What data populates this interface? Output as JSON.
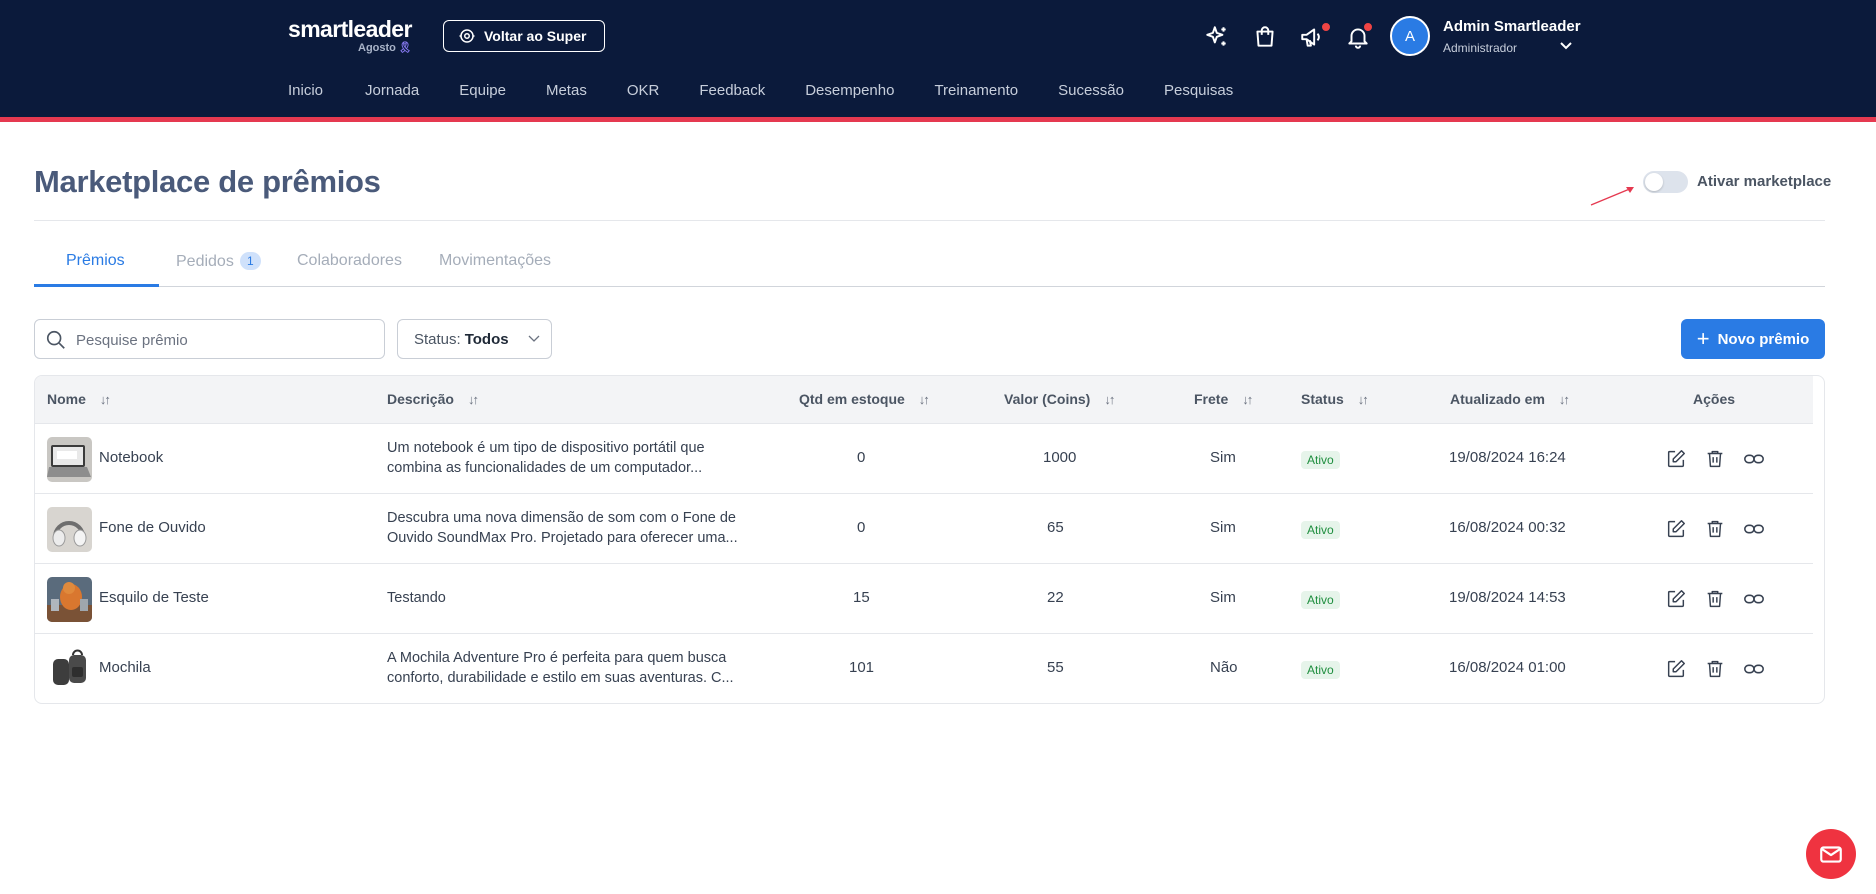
{
  "header": {
    "logo": "smartleader",
    "logo_sub": "Agosto",
    "logo_ribbon": "🎗",
    "back_button": "Voltar ao Super",
    "nav": [
      "Inicio",
      "Jornada",
      "Equipe",
      "Metas",
      "OKR",
      "Feedback",
      "Desempenho",
      "Treinamento",
      "Sucessão",
      "Pesquisas"
    ],
    "user": {
      "initial": "A",
      "name": "Admin Smartleader",
      "role": "Administrador"
    },
    "icons": [
      "sparkles-icon",
      "shopping-bag-icon",
      "megaphone-icon",
      "bell-icon"
    ]
  },
  "page": {
    "title": "Marketplace de prêmios",
    "toggle_label": "Ativar marketplace",
    "toggle_on": false
  },
  "tabs": [
    {
      "label": "Prêmios",
      "active": true
    },
    {
      "label": "Pedidos",
      "badge": "1"
    },
    {
      "label": "Colaboradores"
    },
    {
      "label": "Movimentações"
    }
  ],
  "filters": {
    "search_placeholder": "Pesquise prêmio",
    "status_label": "Status:",
    "status_value": "Todos",
    "new_button": "Novo prêmio"
  },
  "table": {
    "columns": [
      "Nome",
      "Descrição",
      "Qtd em estoque",
      "Valor (Coins)",
      "Frete",
      "Status",
      "Atualizado em",
      "Ações"
    ],
    "rows": [
      {
        "name": "Notebook",
        "desc1": "Um notebook é um tipo de dispositivo portátil que",
        "desc2": "combina as funcionalidades de um computador...",
        "stock": "0",
        "value": "1000",
        "shipping": "Sim",
        "status": "Ativo",
        "updated": "19/08/2024 16:24"
      },
      {
        "name": "Fone de Ouvido",
        "desc1": "Descubra uma nova dimensão de som com o Fone de",
        "desc2": "Ouvido SoundMax Pro. Projetado para oferecer uma...",
        "stock": "0",
        "value": "65",
        "shipping": "Sim",
        "status": "Ativo",
        "updated": "16/08/2024 00:32"
      },
      {
        "name": "Esquilo de Teste",
        "desc1": "Testando",
        "desc2": "",
        "stock": "15",
        "value": "22",
        "shipping": "Sim",
        "status": "Ativo",
        "updated": "19/08/2024 14:53"
      },
      {
        "name": "Mochila",
        "desc1": "A Mochila Adventure Pro é perfeita para quem busca",
        "desc2": "conforto, durabilidade e estilo em suas aventuras. C...",
        "stock": "101",
        "value": "55",
        "shipping": "Não",
        "status": "Ativo",
        "updated": "16/08/2024 01:00"
      }
    ]
  },
  "colors": {
    "header_bg": "#0b1a3b",
    "accent": "#2a7be4",
    "header_stripe": "#e53950",
    "fab": "#ef3340"
  }
}
